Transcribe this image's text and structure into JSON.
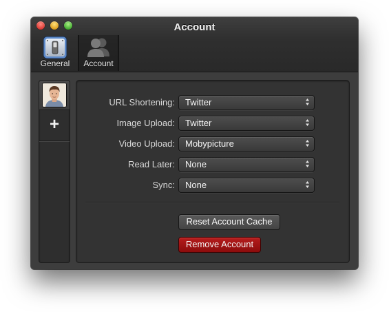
{
  "window": {
    "title": "Account"
  },
  "toolbar": {
    "items": [
      {
        "label": "General",
        "icon": "toggle-switch-icon",
        "selected": false
      },
      {
        "label": "Account",
        "icon": "people-icon",
        "selected": true
      }
    ]
  },
  "sidebar": {
    "add_label": "+"
  },
  "settings": {
    "rows": [
      {
        "label": "URL Shortening:",
        "value": "Twitter"
      },
      {
        "label": "Image Upload:",
        "value": "Twitter"
      },
      {
        "label": "Video Upload:",
        "value": "Mobypicture"
      },
      {
        "label": "Read Later:",
        "value": "None"
      },
      {
        "label": "Sync:",
        "value": "None"
      }
    ],
    "reset_button": "Reset Account Cache",
    "remove_button": "Remove Account"
  },
  "colors": {
    "window_bg": "#3d3d3d",
    "remove_button": "#a01414"
  }
}
